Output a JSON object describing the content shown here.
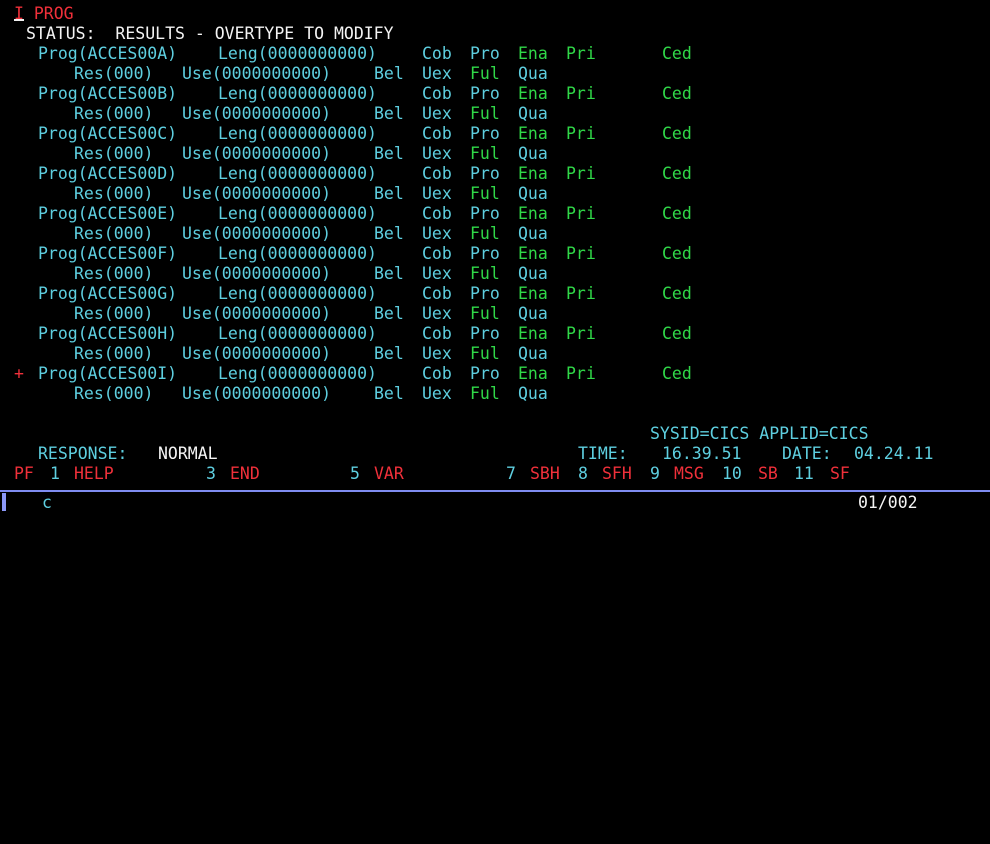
{
  "command_line": "I PROG",
  "status_line": "STATUS:  RESULTS - OVERTYPE TO MODIFY",
  "programs": [
    {
      "marker": "",
      "prog": "Prog(ACCES00A)",
      "leng": "Leng(0000000000)",
      "cob": "Cob",
      "pro": "Pro",
      "ena": "Ena",
      "pri": "Pri",
      "ced": "Ced",
      "res": "Res(000)",
      "use": "Use(0000000000)",
      "bel": "Bel",
      "uex": "Uex",
      "ful": "Ful",
      "qua": "Qua"
    },
    {
      "marker": "",
      "prog": "Prog(ACCES00B)",
      "leng": "Leng(0000000000)",
      "cob": "Cob",
      "pro": "Pro",
      "ena": "Ena",
      "pri": "Pri",
      "ced": "Ced",
      "res": "Res(000)",
      "use": "Use(0000000000)",
      "bel": "Bel",
      "uex": "Uex",
      "ful": "Ful",
      "qua": "Qua"
    },
    {
      "marker": "",
      "prog": "Prog(ACCES00C)",
      "leng": "Leng(0000000000)",
      "cob": "Cob",
      "pro": "Pro",
      "ena": "Ena",
      "pri": "Pri",
      "ced": "Ced",
      "res": "Res(000)",
      "use": "Use(0000000000)",
      "bel": "Bel",
      "uex": "Uex",
      "ful": "Ful",
      "qua": "Qua"
    },
    {
      "marker": "",
      "prog": "Prog(ACCES00D)",
      "leng": "Leng(0000000000)",
      "cob": "Cob",
      "pro": "Pro",
      "ena": "Ena",
      "pri": "Pri",
      "ced": "Ced",
      "res": "Res(000)",
      "use": "Use(0000000000)",
      "bel": "Bel",
      "uex": "Uex",
      "ful": "Ful",
      "qua": "Qua"
    },
    {
      "marker": "",
      "prog": "Prog(ACCES00E)",
      "leng": "Leng(0000000000)",
      "cob": "Cob",
      "pro": "Pro",
      "ena": "Ena",
      "pri": "Pri",
      "ced": "Ced",
      "res": "Res(000)",
      "use": "Use(0000000000)",
      "bel": "Bel",
      "uex": "Uex",
      "ful": "Ful",
      "qua": "Qua"
    },
    {
      "marker": "",
      "prog": "Prog(ACCES00F)",
      "leng": "Leng(0000000000)",
      "cob": "Cob",
      "pro": "Pro",
      "ena": "Ena",
      "pri": "Pri",
      "ced": "Ced",
      "res": "Res(000)",
      "use": "Use(0000000000)",
      "bel": "Bel",
      "uex": "Uex",
      "ful": "Ful",
      "qua": "Qua"
    },
    {
      "marker": "",
      "prog": "Prog(ACCES00G)",
      "leng": "Leng(0000000000)",
      "cob": "Cob",
      "pro": "Pro",
      "ena": "Ena",
      "pri": "Pri",
      "ced": "Ced",
      "res": "Res(000)",
      "use": "Use(0000000000)",
      "bel": "Bel",
      "uex": "Uex",
      "ful": "Ful",
      "qua": "Qua"
    },
    {
      "marker": "",
      "prog": "Prog(ACCES00H)",
      "leng": "Leng(0000000000)",
      "cob": "Cob",
      "pro": "Pro",
      "ena": "Ena",
      "pri": "Pri",
      "ced": "Ced",
      "res": "Res(000)",
      "use": "Use(0000000000)",
      "bel": "Bel",
      "uex": "Uex",
      "ful": "Ful",
      "qua": "Qua"
    },
    {
      "marker": "+",
      "prog": "Prog(ACCES00I)",
      "leng": "Leng(0000000000)",
      "cob": "Cob",
      "pro": "Pro",
      "ena": "Ena",
      "pri": "Pri",
      "ced": "Ced",
      "res": "Res(000)",
      "use": "Use(0000000000)",
      "bel": "Bel",
      "uex": "Uex",
      "ful": "Ful",
      "qua": "Qua"
    }
  ],
  "sysid_line": "SYSID=CICS APPLID=CICS",
  "response": {
    "label": "RESPONSE:",
    "value": "NORMAL"
  },
  "time": {
    "label": "TIME:",
    "value": "16.39.51"
  },
  "date": {
    "label": "DATE:",
    "value": "04.24.11"
  },
  "pf_keys": {
    "pf": "PF",
    "k1": "1",
    "l1": "HELP",
    "k3": "3",
    "l3": "END",
    "k5": "5",
    "l5": "VAR",
    "k7": "7",
    "l7": "SBH",
    "k8": "8",
    "l8": "SFH",
    "k9": "9",
    "l9": "MSG",
    "k10": "10",
    "l10": "SB",
    "k11": "11",
    "l11": "SF"
  },
  "oia": {
    "input_mode": "c",
    "cursor_position": "01/002"
  },
  "colors": {
    "background": "#000000",
    "red": "#f0303a",
    "cyan": "#5ecfe0",
    "green": "#30d848",
    "white": "#f4f4f4"
  }
}
